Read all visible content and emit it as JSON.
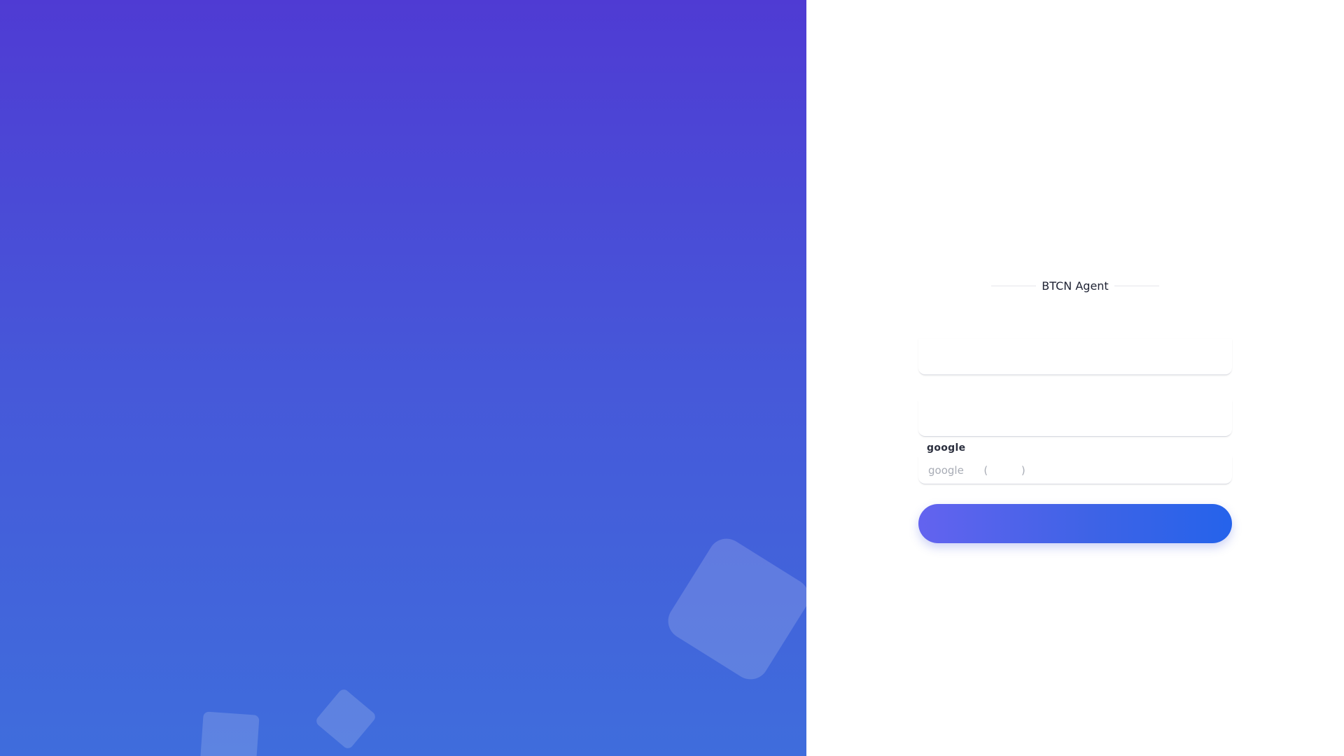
{
  "brand": {
    "title": "BTCN Agent"
  },
  "form": {
    "username": {
      "label": "",
      "placeholder": ""
    },
    "password": {
      "label": "",
      "placeholder": ""
    },
    "google_code": {
      "label": "google",
      "placeholder": "google      (          )"
    },
    "submit_label": ""
  },
  "colors": {
    "left_gradient_top": "#4f3bd3",
    "left_gradient_bottom": "#3f6ddc",
    "button_gradient_start": "#6363ef",
    "button_gradient_end": "#2563eb"
  }
}
